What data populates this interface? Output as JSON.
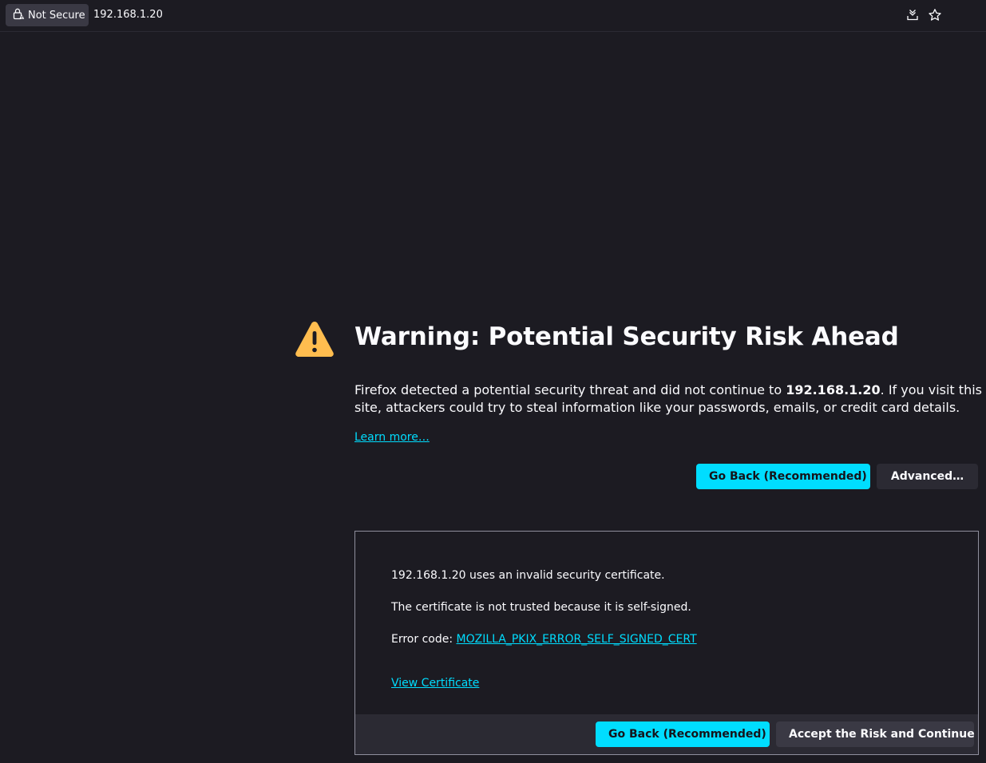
{
  "toolbar": {
    "not_secure_label": "Not Secure",
    "url": "192.168.1.20",
    "save_icon": "download-to-pocket-icon",
    "bookmark_icon": "star-icon"
  },
  "warning": {
    "title": "Warning: Potential Security Risk Ahead",
    "desc_prefix": "Firefox detected a potential security threat and did not continue to ",
    "desc_host": "192.168.1.20",
    "desc_suffix": ". If you visit this site, attackers could try to steal information like your passwords, emails, or credit card details.",
    "learn_more": "Learn more…",
    "go_back_label": "Go Back (Recommended)",
    "advanced_label": "Advanced…"
  },
  "advanced": {
    "line1": "192.168.1.20 uses an invalid security certificate.",
    "line2": "The certificate is not trusted because it is self-signed.",
    "error_code_label": "Error code: ",
    "error_code": "MOZILLA_PKIX_ERROR_SELF_SIGNED_CERT",
    "view_certificate": "View Certificate",
    "go_back_label": "Go Back (Recommended)",
    "accept_label": "Accept the Risk and Continue"
  },
  "colors": {
    "background": "#1c1b22",
    "accent": "#00ddff",
    "warning_icon": "#ffbd4f"
  }
}
